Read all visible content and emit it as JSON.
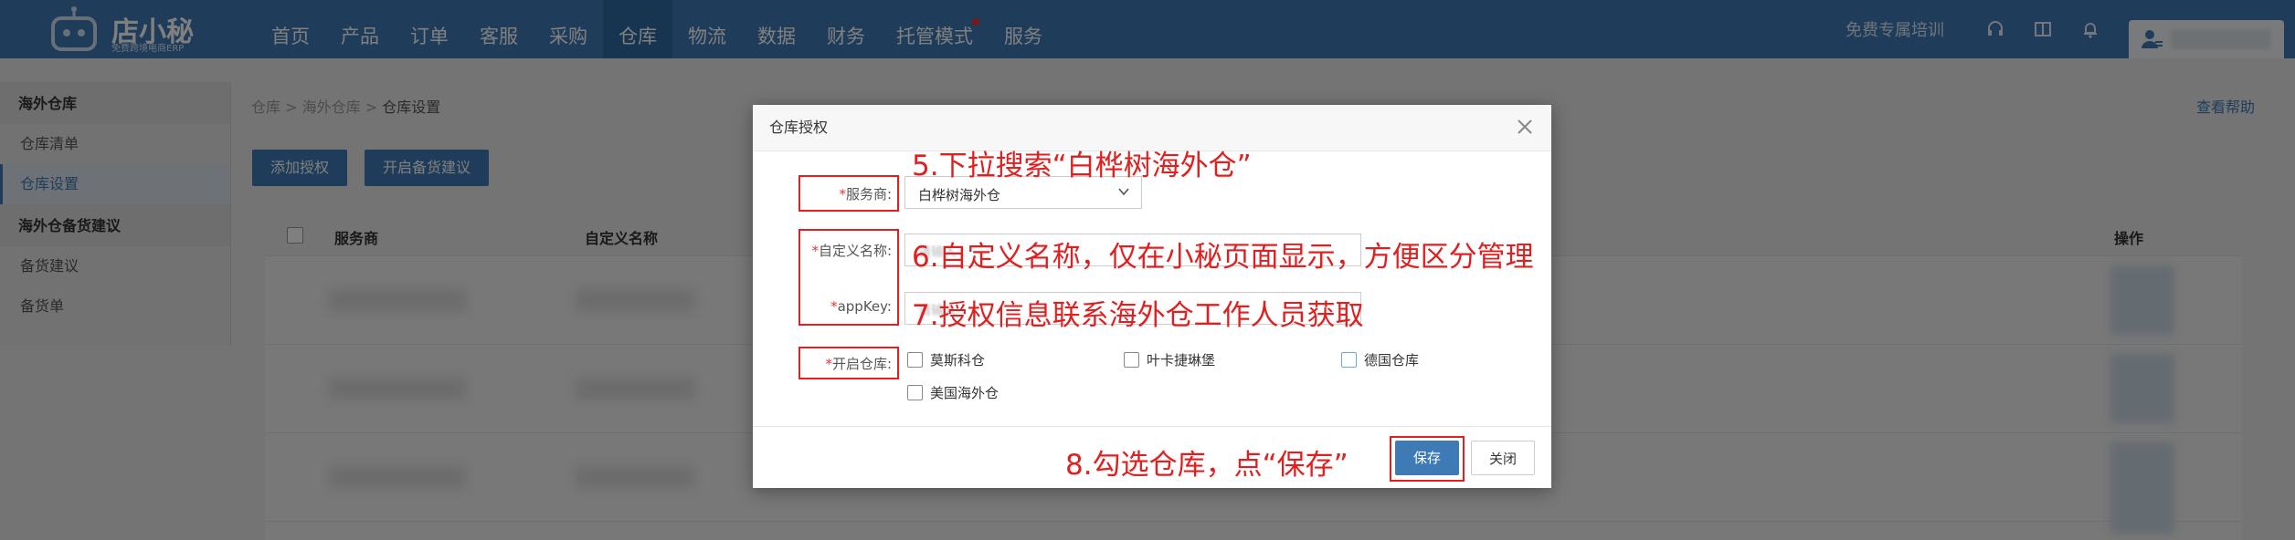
{
  "brand": {
    "name": "店小秘",
    "tagline": "免费跨境电商ERP"
  },
  "nav": {
    "items": [
      "首页",
      "产品",
      "订单",
      "客服",
      "采购",
      "仓库",
      "物流",
      "数据",
      "财务",
      "托管模式",
      "服务"
    ],
    "active_index": 5,
    "training_label": "免费专属培训"
  },
  "sidebar": {
    "section1_title": "海外仓库",
    "section1_items": [
      "仓库清单",
      "仓库设置"
    ],
    "section2_title": "海外仓备货建议",
    "section2_items": [
      "备货建议",
      "备货单"
    ]
  },
  "breadcrumb": {
    "a": "仓库",
    "b": "海外仓库",
    "c": "仓库设置",
    "sep": ">"
  },
  "help_label": "查看帮助",
  "toolbar": {
    "add_auth": "添加授权",
    "stock_suggest": "开启备货建议"
  },
  "table": {
    "col_provider": "服务商",
    "col_custom_name": "自定义名称",
    "col_ops": "操作"
  },
  "modal": {
    "title": "仓库授权",
    "provider_label": "服务商:",
    "provider_value": "白桦树海外仓",
    "custom_name_label": "自定义名称:",
    "appkey_label": "appKey:",
    "placeholder_custom": "请输入",
    "placeholder_appkey": "请输入",
    "warehouse_label": "开启仓库:",
    "required_mark": "*",
    "warehouses": [
      "莫斯科仓",
      "叶卡捷琳堡",
      "德国仓库",
      "美国海外仓"
    ],
    "save_label": "保存",
    "close_label": "关闭"
  },
  "annotations": {
    "step5": "5.下拉搜索“白桦树海外仓”",
    "step6": "6.自定义名称，仅在小秘页面显示，方便区分管理",
    "step7": "7.授权信息联系海外仓工作人员获取",
    "step8": "8.勾选仓库，点“保存”"
  },
  "colors": {
    "primary": "#3e7bb6",
    "annotation_red": "#e02020"
  }
}
